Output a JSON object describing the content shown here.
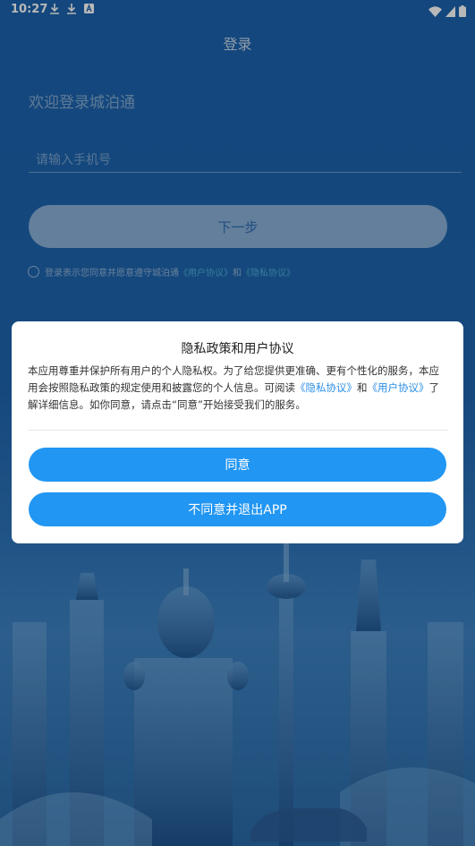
{
  "status_bar": {
    "time": "10:27",
    "left_icons": [
      "download-icon",
      "download-icon",
      "a-icon"
    ],
    "right_icons": [
      "wifi-icon",
      "signal-icon",
      "battery-icon"
    ]
  },
  "login": {
    "title": "登录",
    "welcome": "欢迎登录城泊通",
    "phone_placeholder": "请输入手机号",
    "next_label": "下一步",
    "agree_prefix": "登录表示您同意并愿意遵守城泊通",
    "agree_user_protocol": "《用户协议》",
    "agree_and": "和",
    "agree_privacy_protocol": "《隐私协议》"
  },
  "dialog": {
    "title": "隐私政策和用户协议",
    "body_part1": "本应用尊重并保护所有用户的个人隐私权。为了给您提供更准确、更有个性化的服务，本应用会按照隐私政策的规定使用和披露您的个人信息。可阅读",
    "privacy_link": "《隐私协议》",
    "body_and": "和",
    "user_link": "《用户协议》",
    "body_part2": "了解详细信息。如你同意，请点击“同意”开始接受我们的服务。",
    "agree_label": "同意",
    "disagree_label": "不同意并退出APP"
  },
  "colors": {
    "background": "#1d63ad",
    "accent": "#2196f3",
    "dialog_bg": "#ffffff"
  }
}
